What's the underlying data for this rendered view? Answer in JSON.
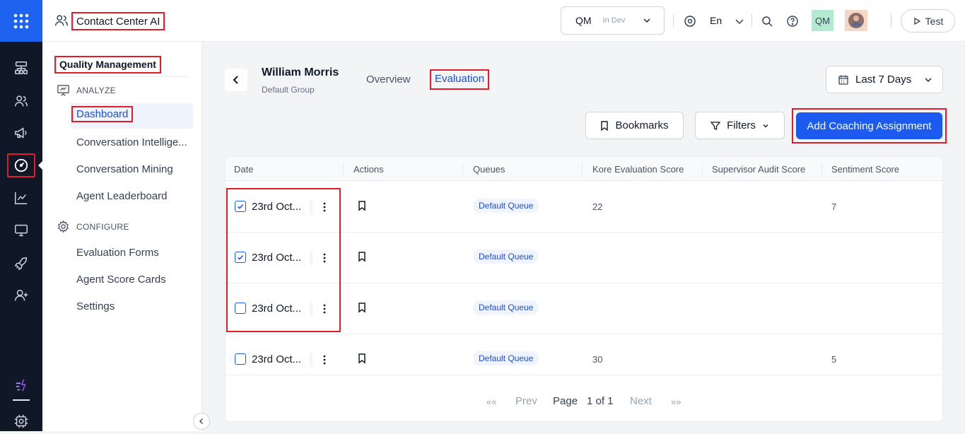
{
  "app": {
    "title": "Contact Center AI"
  },
  "environment": {
    "name": "QM",
    "status": "In Dev"
  },
  "topbar": {
    "language": "En",
    "user_initials": "QM",
    "test_label": "Test"
  },
  "sidebar": {
    "section_title": "Quality Management",
    "groups": [
      {
        "label": "ANALYZE",
        "icon": "presentation-icon",
        "items": [
          "Dashboard",
          "Conversation Intellige...",
          "Conversation Mining",
          "Agent Leaderboard"
        ]
      },
      {
        "label": "CONFIGURE",
        "icon": "gear-icon",
        "items": [
          "Evaluation Forms",
          "Agent Score Cards",
          "Settings"
        ]
      }
    ],
    "active_item": "Dashboard"
  },
  "header": {
    "agent_name": "William Morris",
    "agent_group": "Default Group",
    "tabs": [
      "Overview",
      "Evaluation"
    ],
    "active_tab": "Evaluation",
    "date_range": "Last 7 Days"
  },
  "toolbar": {
    "bookmarks_label": "Bookmarks",
    "filters_label": "Filters",
    "add_coaching_label": "Add Coaching Assignment"
  },
  "table": {
    "columns": [
      "Date",
      "Actions",
      "Queues",
      "Kore Evaluation Score",
      "Supervisor Audit Score",
      "Sentiment Score"
    ],
    "rows": [
      {
        "checked": true,
        "date": "23rd Oct...",
        "queue": "Default Queue",
        "kore_score": "22",
        "supervisor_score": "",
        "sentiment": "7"
      },
      {
        "checked": true,
        "date": "23rd Oct...",
        "queue": "Default Queue",
        "kore_score": "",
        "supervisor_score": "",
        "sentiment": ""
      },
      {
        "checked": false,
        "date": "23rd Oct...",
        "queue": "Default Queue",
        "kore_score": "",
        "supervisor_score": "",
        "sentiment": ""
      },
      {
        "checked": false,
        "date": "23rd Oct...",
        "queue": "Default Queue",
        "kore_score": "30",
        "supervisor_score": "",
        "sentiment": "5"
      }
    ]
  },
  "pagination": {
    "first": "««",
    "prev": "Prev",
    "page_label": "Page",
    "page_value": "1 of 1",
    "next": "Next",
    "last": "»»"
  },
  "colors": {
    "primary": "#1d5bf0",
    "highlight": "#e11d2a",
    "rail": "#101828"
  }
}
